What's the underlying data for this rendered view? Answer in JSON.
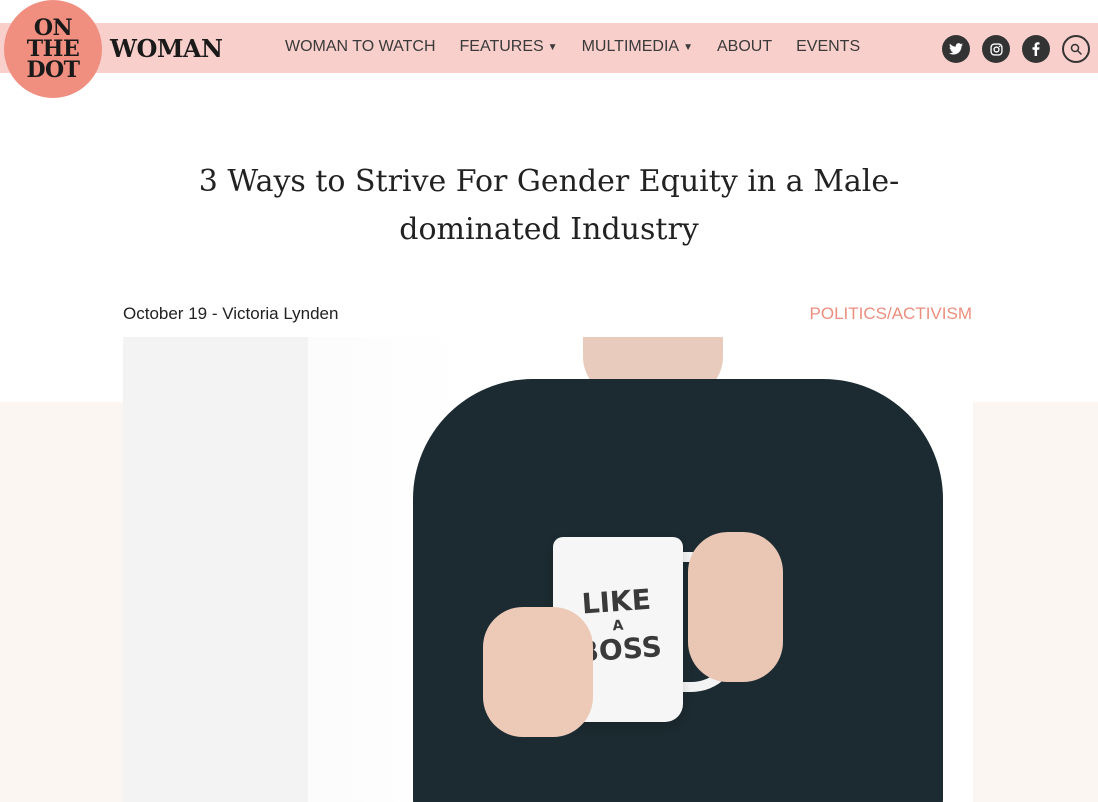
{
  "logo": {
    "line1": "ON",
    "line2": "THE",
    "line3": "DOT"
  },
  "brand": "WOMAN",
  "nav": {
    "items": [
      {
        "label": "WOMAN TO WATCH",
        "dropdown": false
      },
      {
        "label": "FEATURES",
        "dropdown": true
      },
      {
        "label": "MULTIMEDIA",
        "dropdown": true
      },
      {
        "label": "ABOUT",
        "dropdown": false
      },
      {
        "label": "EVENTS",
        "dropdown": false
      }
    ]
  },
  "social": {
    "icons": [
      "twitter-icon",
      "instagram-icon",
      "facebook-icon",
      "search-icon"
    ]
  },
  "article": {
    "title": "3 Ways to Strive For Gender Equity in a Male-dominated Industry",
    "meta": "October 19 - Victoria Lynden",
    "category": "POLITICS/ACTIVISM",
    "hero_image": {
      "mug_line1": "LIKE",
      "mug_line2": "A",
      "mug_line3": "BOSS"
    }
  },
  "colors": {
    "nav_bg": "#f8cfcb",
    "logo_circle": "#f08f80",
    "accent": "#ec8e7e",
    "band_bg": "#fcf6f3"
  }
}
